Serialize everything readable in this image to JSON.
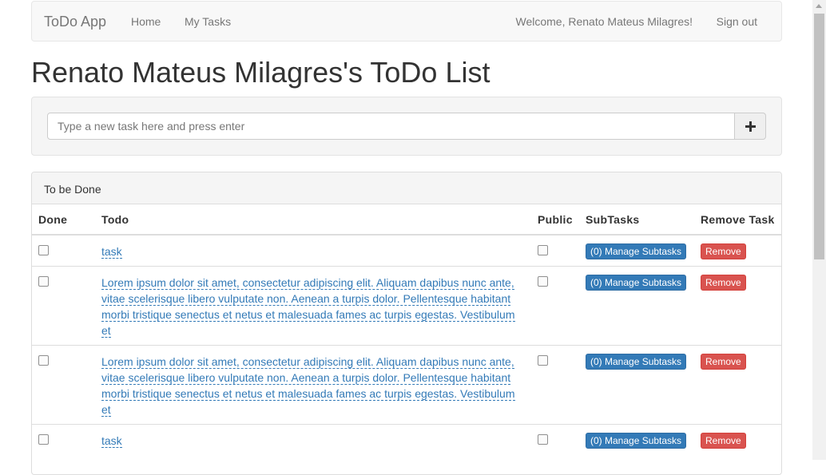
{
  "navbar": {
    "brand": "ToDo App",
    "links": [
      "Home",
      "My Tasks"
    ],
    "welcome": "Welcome, Renato Mateus Milagres!",
    "signout": "Sign out"
  },
  "page_title": "Renato Mateus Milagres's ToDo List",
  "new_task": {
    "placeholder": "Type a new task here and press enter",
    "value": "",
    "add_icon": "plus-icon"
  },
  "panel": {
    "heading": "To be Done",
    "columns": [
      "Done",
      "Todo",
      "Public",
      "SubTasks",
      "Remove Task"
    ],
    "rows": [
      {
        "done": false,
        "todo": "task",
        "public": false,
        "subtasks": "(0) Manage Subtasks",
        "remove": "Remove"
      },
      {
        "done": false,
        "todo": "Lorem ipsum dolor sit amet, consectetur adipiscing elit. Aliquam dapibus nunc ante, vitae scelerisque libero vulputate non. Aenean a turpis dolor. Pellentesque habitant morbi tristique senectus et netus et malesuada fames ac turpis egestas. Vestibulum et",
        "public": false,
        "subtasks": "(0) Manage Subtasks",
        "remove": "Remove"
      },
      {
        "done": false,
        "todo": "Lorem ipsum dolor sit amet, consectetur adipiscing elit. Aliquam dapibus nunc ante, vitae scelerisque libero vulputate non. Aenean a turpis dolor. Pellentesque habitant morbi tristique senectus et netus et malesuada fames ac turpis egestas. Vestibulum et",
        "public": false,
        "subtasks": "(0) Manage Subtasks",
        "remove": "Remove"
      },
      {
        "done": false,
        "todo": "task",
        "public": false,
        "subtasks": "(0) Manage Subtasks",
        "remove": "Remove"
      }
    ]
  },
  "colors": {
    "primary": "#337ab7",
    "danger": "#d9534f",
    "navbar_bg": "#f8f8f8"
  }
}
